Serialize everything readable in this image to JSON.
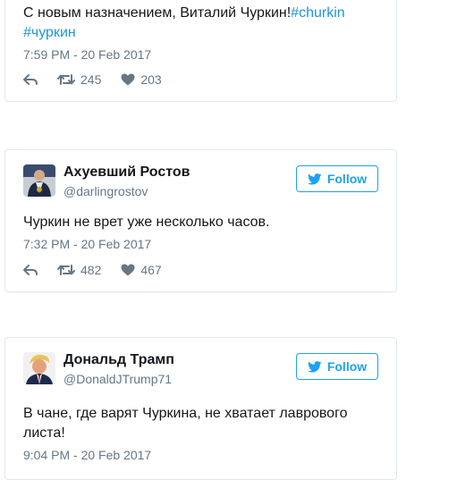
{
  "tweets": [
    {
      "text_main": "С новым назначением, Виталий Чуркин!",
      "hashtag1": "#churkin",
      "hashtag2": "#чуркин",
      "time": "7:59 PM - 20 Feb 2017",
      "retweets": "245",
      "likes": "203"
    },
    {
      "name": "Ахуевший Ростов",
      "handle": "@darlingrostov",
      "follow_label": "Follow",
      "text_main": "Чуркин не врет уже несколько часов.",
      "time": "7:32 PM - 20 Feb 2017",
      "retweets": "482",
      "likes": "467"
    },
    {
      "name": "Дональд Трамп",
      "handle": "@DonaldJTrump71",
      "follow_label": "Follow",
      "text_main": "В чане, где варят Чуркина, не хватает лаврового листа!",
      "time": "9:04 PM - 20 Feb 2017"
    }
  ],
  "colors": {
    "link": "#1b95e0",
    "follow": "#1da1f2",
    "muted": "#657786",
    "border": "#e1e8ed"
  }
}
